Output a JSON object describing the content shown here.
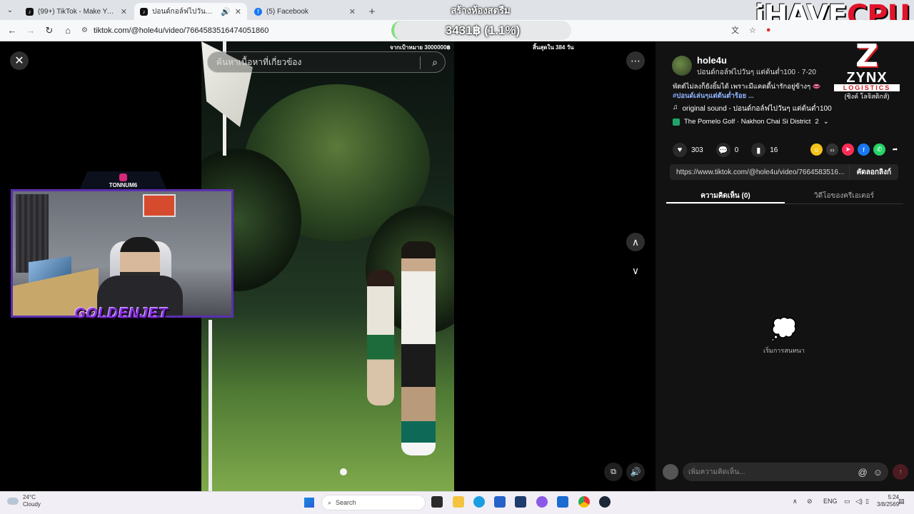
{
  "browser": {
    "tabs": [
      {
        "title": "(99+) TikTok - Make Your Day",
        "active": false
      },
      {
        "title": "ปอนด์กอล์ฟไปวันๆ แต่ต้นต่ำ100",
        "active": true
      },
      {
        "title": "(5) Facebook",
        "active": false
      }
    ],
    "url": "tiktok.com/@hole4u/video/7664583516474051860"
  },
  "stream_overlay": {
    "top_title": "สร้างห้องสตรีม",
    "brand_a": "iHAVE",
    "brand_b": "CPU",
    "donation": "3431฿ (1.1%)",
    "goal_text": "จากเป้าหมาย 3000000฿",
    "days_left": "สิ้นสุดใน 384 วัน",
    "cam_name": "TONNUM6",
    "cam_logo": "GOLDENJET",
    "sponsor_big": "Z",
    "sponsor_name": "ZYNX",
    "sponsor_sub": "LOGISTICS",
    "sponsor_thai": "(ซิงค์ โลจิสติกส์)"
  },
  "video": {
    "search_placeholder": "ค้นหาเนื้อหาที่เกี่ยวข้อง"
  },
  "post": {
    "username": "hole4u",
    "subtitle": "ปอนด์กอล์ฟไปวันๆ แต่ต้นต่ำ100 · 7-20",
    "description": "พัตต์ไม่ลงก็ยังยิ้มได้ เพราะมีแคดดี้น่ารักอยู่ข้างๆ 👄",
    "hashtag": "#ปอนด์เล่นๆแต่ต้นต่ำร้อย ...",
    "music": "original sound - ปอนด์กอล์ฟไปวันๆ แต่ต้นต่ำ100",
    "location": "The Pomelo Golf · Nakhon Chai Si District",
    "location_count": "2",
    "likes": "303",
    "comments": "0",
    "saves": "16",
    "link": "https://www.tiktok.com/@hole4u/video/7664583516...",
    "copy_label": "คัดลอกลิงก์",
    "tab_comments": "ความคิดเห็น (0)",
    "tab_creator": "วิดีโอของครีเอเตอร์",
    "empty_text": "เริ่มการสนทนา",
    "comment_placeholder": "เพิ่มความคิดเห็น..."
  },
  "taskbar": {
    "temp": "24°C",
    "weather": "Cloudy",
    "search": "Search",
    "lang": "ENG",
    "time": "5:24",
    "date": "3/8/2569"
  }
}
